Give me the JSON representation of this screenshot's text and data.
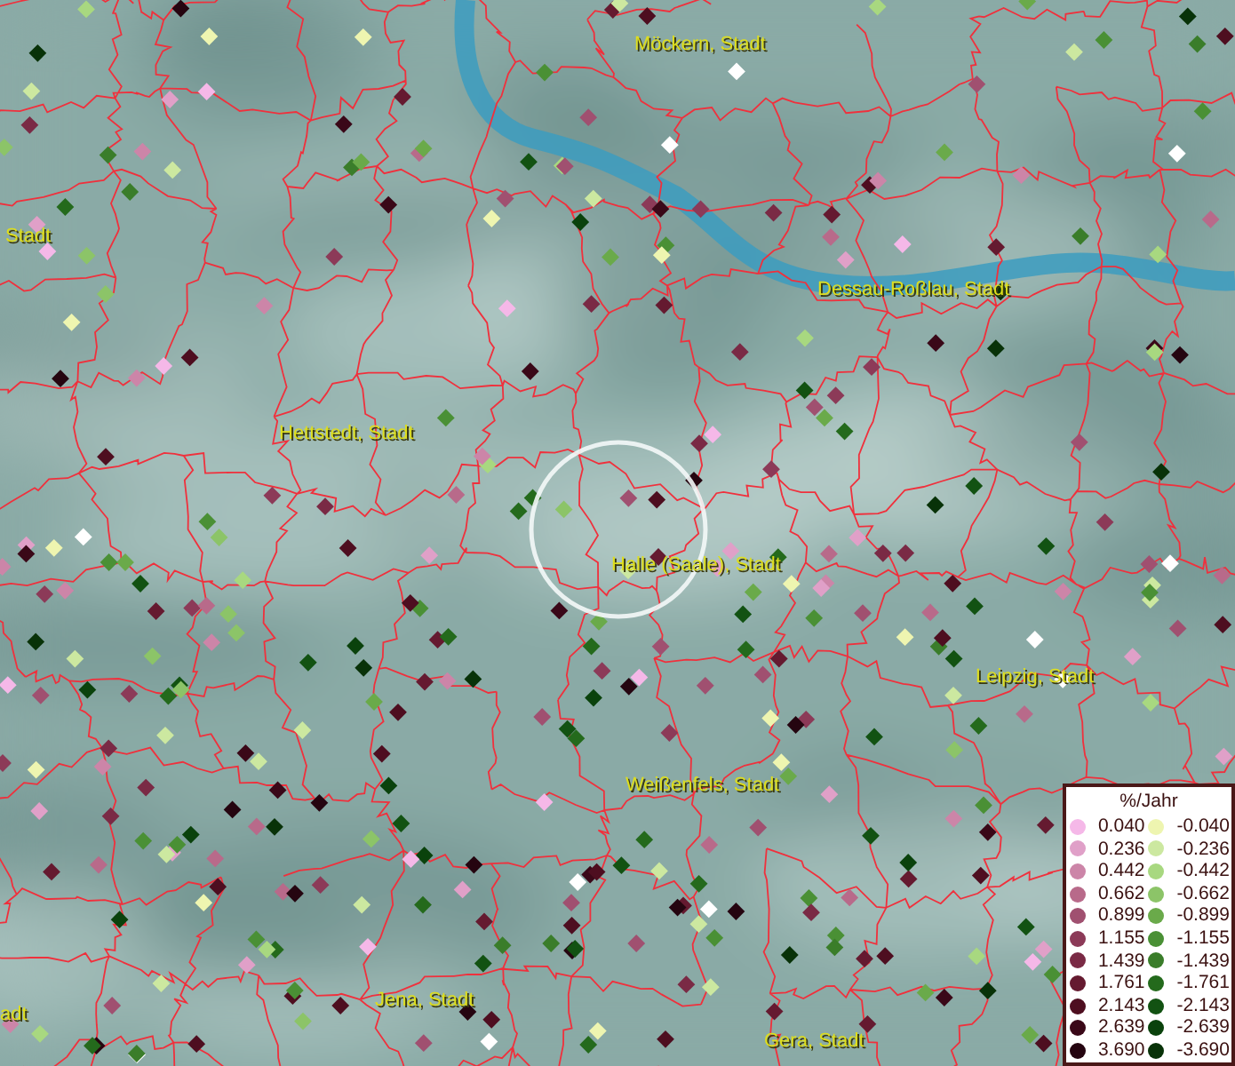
{
  "map": {
    "places": [
      {
        "name": "Möckern, Stadt"
      },
      {
        "name": "Stadt"
      },
      {
        "name": "Dessau-Roßlau, Stadt"
      },
      {
        "name": "Hettstedt, Stadt"
      },
      {
        "name": "Halle (Saale), Stadt"
      },
      {
        "name": "Leipzig, Stadt"
      },
      {
        "name": "Weißenfels, Stadt"
      },
      {
        "name": "Jena, Stadt"
      },
      {
        "name": "adt"
      },
      {
        "name": "Gera, Stadt"
      }
    ]
  },
  "legend": {
    "title": "%/Jahr",
    "rows": [
      {
        "positive": {
          "value": "0.040",
          "color": "#f5b8e8"
        },
        "negative": {
          "value": "-0.040",
          "color": "#eef5b0"
        }
      },
      {
        "positive": {
          "value": "0.236",
          "color": "#e0a0c8"
        },
        "negative": {
          "value": "-0.236",
          "color": "#cce8a0"
        }
      },
      {
        "positive": {
          "value": "0.442",
          "color": "#cc85a8"
        },
        "negative": {
          "value": "-0.442",
          "color": "#a8d880"
        }
      },
      {
        "positive": {
          "value": "0.662",
          "color": "#b86a8a"
        },
        "negative": {
          "value": "-0.662",
          "color": "#8cc468"
        }
      },
      {
        "positive": {
          "value": "0.899",
          "color": "#a05070"
        },
        "negative": {
          "value": "-0.899",
          "color": "#6aaa4a"
        }
      },
      {
        "positive": {
          "value": "1.155",
          "color": "#8c3a58"
        },
        "negative": {
          "value": "-1.155",
          "color": "#4a9035"
        }
      },
      {
        "positive": {
          "value": "1.439",
          "color": "#7a2a45"
        },
        "negative": {
          "value": "-1.439",
          "color": "#3a7d2a"
        }
      },
      {
        "positive": {
          "value": "1.761",
          "color": "#651a30"
        },
        "negative": {
          "value": "-1.761",
          "color": "#246a1c"
        }
      },
      {
        "positive": {
          "value": "2.143",
          "color": "#4e0e20"
        },
        "negative": {
          "value": "-2.143",
          "color": "#125212"
        }
      },
      {
        "positive": {
          "value": "2.639",
          "color": "#3a0818"
        },
        "negative": {
          "value": "-2.639",
          "color": "#0a420c"
        }
      },
      {
        "positive": {
          "value": "3.690",
          "color": "#250510"
        },
        "negative": {
          "value": "-3.690",
          "color": "#083208"
        }
      }
    ]
  }
}
